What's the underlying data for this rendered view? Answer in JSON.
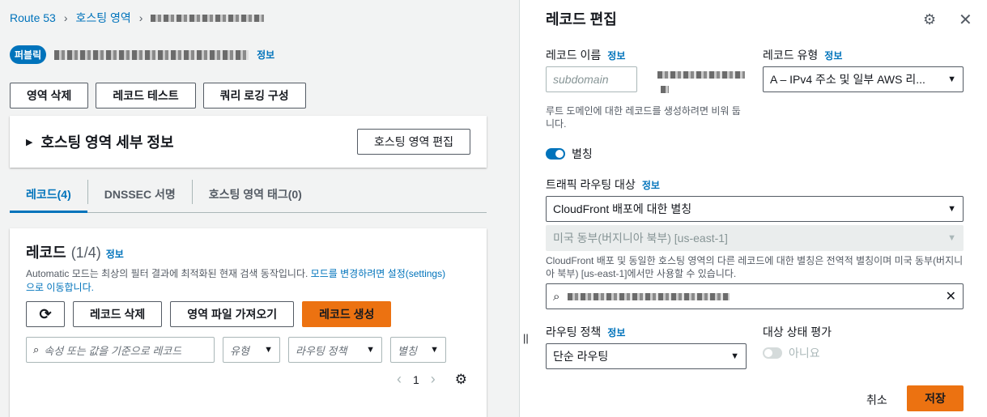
{
  "breadcrumb": {
    "root": "Route 53",
    "zones": "호스팅 영역"
  },
  "zone": {
    "badge": "퍼블릭",
    "info": "정보"
  },
  "top_buttons": {
    "delete_zone": "영역 삭제",
    "test_record": "레코드 테스트",
    "query_logging": "쿼리 로깅 구성"
  },
  "details": {
    "title": "호스팅 영역 세부 정보",
    "edit": "호스팅 영역 편집"
  },
  "tabs": [
    {
      "label": "레코드(4)"
    },
    {
      "label": "DNSSEC 서명"
    },
    {
      "label": "호스팅 영역 태그(0)"
    }
  ],
  "records": {
    "title": "레코드",
    "count": "(1/4)",
    "info": "정보",
    "desc_prefix": "Automatic 모드는 최상의 필터 결과에 최적화된 현재 검색 동작입니다.",
    "desc_link": "모드를 변경하려면 설정(settings)으로 이동합니다.",
    "delete": "레코드 삭제",
    "import": "영역 파일 가져오기",
    "create": "레코드 생성",
    "search_placeholder": "속성 또는 값을 기준으로 레코드",
    "filter_type": "유형",
    "filter_routing": "라우팅 정책",
    "filter_alias": "별칭",
    "page": "1"
  },
  "editor": {
    "title": "레코드 편집",
    "record_name": {
      "label": "레코드 이름",
      "info": "정보",
      "placeholder": "subdomain",
      "hint": "루트 도메인에 대한 레코드를 생성하려면 비워 둡니다."
    },
    "record_type": {
      "label": "레코드 유형",
      "info": "정보",
      "value": "A – IPv4 주소 및 일부 AWS 리..."
    },
    "alias": {
      "label": "별칭",
      "enabled": true
    },
    "traffic_target": {
      "label": "트래픽 라우팅 대상",
      "info": "정보",
      "value": "CloudFront 배포에 대한 별칭",
      "region": "미국 동부(버지니아 북부) [us-east-1]",
      "hint": "CloudFront 배포 및 동일한 호스팅 영역의 다른 레코드에 대한 별칭은 전역적 별칭이며 미국 동부(버지니아 북부) [us-east-1]에서만 사용할 수 있습니다."
    },
    "routing_policy": {
      "label": "라우팅 정책",
      "info": "정보",
      "value": "단순 라우팅"
    },
    "health_eval": {
      "label": "대상 상태 평가",
      "toggle_label": "아니요",
      "enabled": false
    },
    "cancel": "취소",
    "save": "저장"
  },
  "colors": {
    "accent": "#0073bb",
    "primary_button": "#ec7211"
  }
}
